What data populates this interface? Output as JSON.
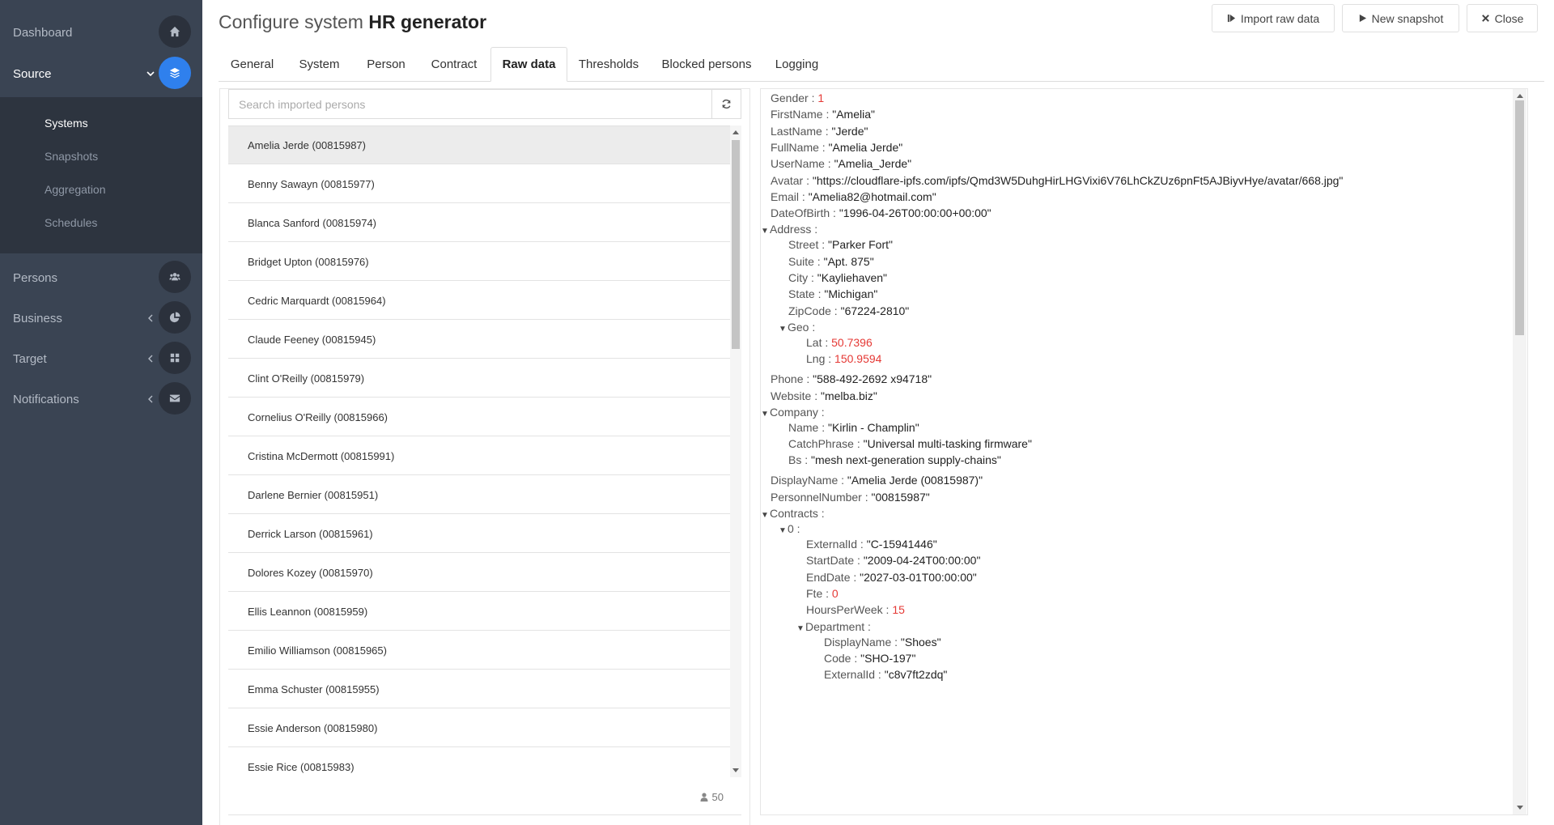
{
  "sidebar": {
    "items": [
      {
        "label": "Dashboard",
        "icon": "home-icon"
      },
      {
        "label": "Source",
        "icon": "layers-icon"
      },
      {
        "label": "Persons",
        "icon": "users-icon"
      },
      {
        "label": "Business",
        "icon": "chart-icon"
      },
      {
        "label": "Target",
        "icon": "grid-icon"
      },
      {
        "label": "Notifications",
        "icon": "envelope-icon"
      }
    ],
    "sub_items": [
      "Systems",
      "Snapshots",
      "Aggregation",
      "Schedules"
    ]
  },
  "header": {
    "title_prefix": "Configure system",
    "title_name": "HR generator",
    "import_label": "Import raw data",
    "snapshot_label": "New snapshot",
    "close_label": "Close"
  },
  "tabs": [
    "General",
    "System",
    "Person",
    "Contract",
    "Raw data",
    "Thresholds",
    "Blocked persons",
    "Logging"
  ],
  "search": {
    "placeholder": "Search imported persons"
  },
  "persons": [
    "Amelia Jerde (00815987)",
    "Benny Sawayn (00815977)",
    "Blanca Sanford (00815974)",
    "Bridget Upton (00815976)",
    "Cedric Marquardt (00815964)",
    "Claude Feeney (00815945)",
    "Clint O'Reilly (00815979)",
    "Cornelius O'Reilly (00815966)",
    "Cristina McDermott (00815991)",
    "Darlene Bernier (00815951)",
    "Derrick Larson (00815961)",
    "Dolores Kozey (00815970)",
    "Ellis Leannon (00815959)",
    "Emilio Williamson (00815965)",
    "Emma Schuster (00815955)",
    "Essie Anderson (00815980)",
    "Essie Rice (00815983)"
  ],
  "person_count": "50",
  "raw": [
    {
      "k": "Gender",
      "v": "1",
      "num": true,
      "lvl": 0
    },
    {
      "k": "FirstName",
      "v": "\"Amelia\"",
      "lvl": 0
    },
    {
      "k": "LastName",
      "v": "\"Jerde\"",
      "lvl": 0
    },
    {
      "k": "FullName",
      "v": "\"Amelia Jerde\"",
      "lvl": 0
    },
    {
      "k": "UserName",
      "v": "\"Amelia_Jerde\"",
      "lvl": 0
    },
    {
      "k": "Avatar",
      "v": "\"https://cloudflare-ipfs.com/ipfs/Qmd3W5DuhgHirLHGVixi6V76LhCkZUz6pnFt5AJBiyvHye/avatar/668.jpg\"",
      "lvl": 0
    },
    {
      "k": "Email",
      "v": "\"Amelia82@hotmail.com\"",
      "lvl": 0
    },
    {
      "k": "DateOfBirth",
      "v": "\"1996-04-26T00:00:00+00:00\"",
      "lvl": 0
    },
    {
      "k": "Address",
      "v": "",
      "lvl": 0,
      "group": true
    },
    {
      "k": "Street",
      "v": "\"Parker Fort\"",
      "lvl": 1
    },
    {
      "k": "Suite",
      "v": "\"Apt. 875\"",
      "lvl": 1
    },
    {
      "k": "City",
      "v": "\"Kayliehaven\"",
      "lvl": 1
    },
    {
      "k": "State",
      "v": "\"Michigan\"",
      "lvl": 1
    },
    {
      "k": "ZipCode",
      "v": "\"67224-2810\"",
      "lvl": 1
    },
    {
      "k": "Geo",
      "v": "",
      "lvl": 1,
      "group": true
    },
    {
      "k": "Lat",
      "v": "50.7396",
      "num": true,
      "lvl": 2
    },
    {
      "k": "Lng",
      "v": "150.9594",
      "num": true,
      "lvl": 2
    },
    {
      "k": "Phone",
      "v": "\"588-492-2692 x94718\"",
      "lvl": 0
    },
    {
      "k": "Website",
      "v": "\"melba.biz\"",
      "lvl": 0
    },
    {
      "k": "Company",
      "v": "",
      "lvl": 0,
      "group": true
    },
    {
      "k": "Name",
      "v": "\"Kirlin - Champlin\"",
      "lvl": 1
    },
    {
      "k": "CatchPhrase",
      "v": "\"Universal multi-tasking firmware\"",
      "lvl": 1
    },
    {
      "k": "Bs",
      "v": "\"mesh next-generation supply-chains\"",
      "lvl": 1
    },
    {
      "k": "DisplayName",
      "v": "\"Amelia Jerde (00815987)\"",
      "lvl": 0
    },
    {
      "k": "PersonnelNumber",
      "v": "\"00815987\"",
      "lvl": 0
    },
    {
      "k": "Contracts",
      "v": "",
      "lvl": 0,
      "group": true
    },
    {
      "k": "0",
      "v": "",
      "lvl": 1,
      "group": true
    },
    {
      "k": "ExternalId",
      "v": "\"C-15941446\"",
      "lvl": 2
    },
    {
      "k": "StartDate",
      "v": "\"2009-04-24T00:00:00\"",
      "lvl": 2
    },
    {
      "k": "EndDate",
      "v": "\"2027-03-01T00:00:00\"",
      "lvl": 2
    },
    {
      "k": "Fte",
      "v": "0",
      "num": true,
      "lvl": 2
    },
    {
      "k": "HoursPerWeek",
      "v": "15",
      "num": true,
      "lvl": 2
    },
    {
      "k": "Department",
      "v": "",
      "lvl": 2,
      "group": true
    },
    {
      "k": "DisplayName",
      "v": "\"Shoes\"",
      "lvl": 3
    },
    {
      "k": "Code",
      "v": "\"SHO-197\"",
      "lvl": 3
    },
    {
      "k": "ExternalId",
      "v": "\"c8v7ft2zdq\"",
      "lvl": 3
    }
  ]
}
